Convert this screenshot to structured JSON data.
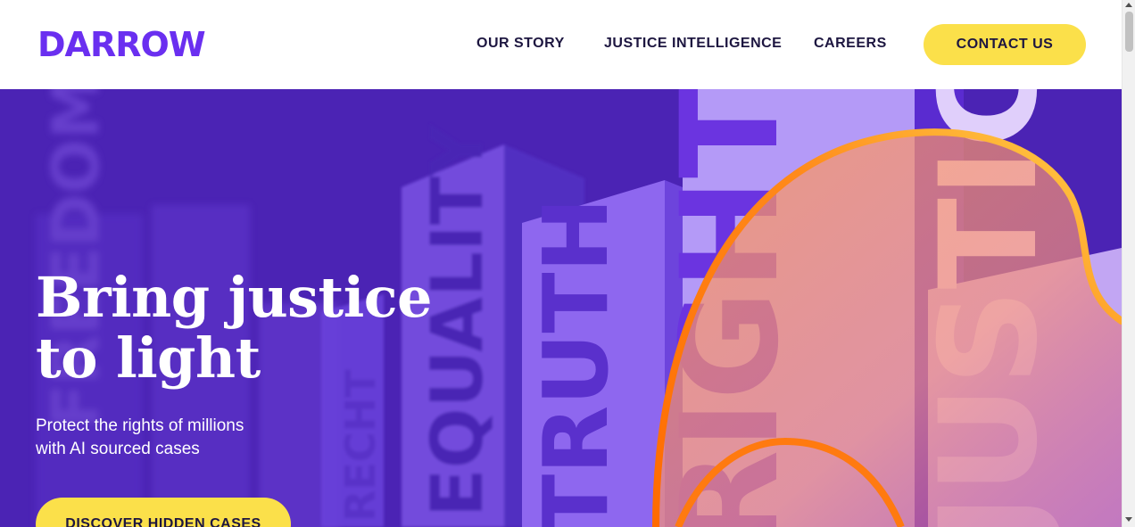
{
  "brand": {
    "logo_text": "DARROW",
    "accent": "#6a2ff0",
    "yellow": "#fbe04a",
    "hero_bg": "#4b23b4"
  },
  "nav": {
    "items": [
      {
        "label": "OUR STORY"
      },
      {
        "label": "JUSTICE INTELLIGENCE"
      },
      {
        "label": "CAREERS"
      }
    ],
    "contact_label": "CONTACT US"
  },
  "hero": {
    "title_lines": [
      "Bring justice",
      "to light"
    ],
    "subtitle_lines": [
      "Protect the rights of millions",
      "with AI sourced cases"
    ],
    "cta_label": "DISCOVER HIDDEN CASES",
    "background_words": [
      "EQUALITY",
      "TRUTH",
      "RIGHTS",
      "JUSTICE",
      "FREEDOM"
    ]
  }
}
